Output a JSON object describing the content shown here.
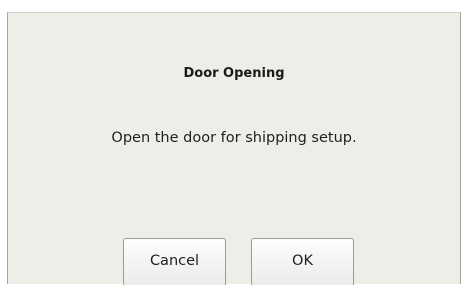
{
  "dialog": {
    "title": "Door Opening",
    "message": "Open the door for shipping setup.",
    "cancel_label": "Cancel",
    "ok_label": "OK"
  }
}
